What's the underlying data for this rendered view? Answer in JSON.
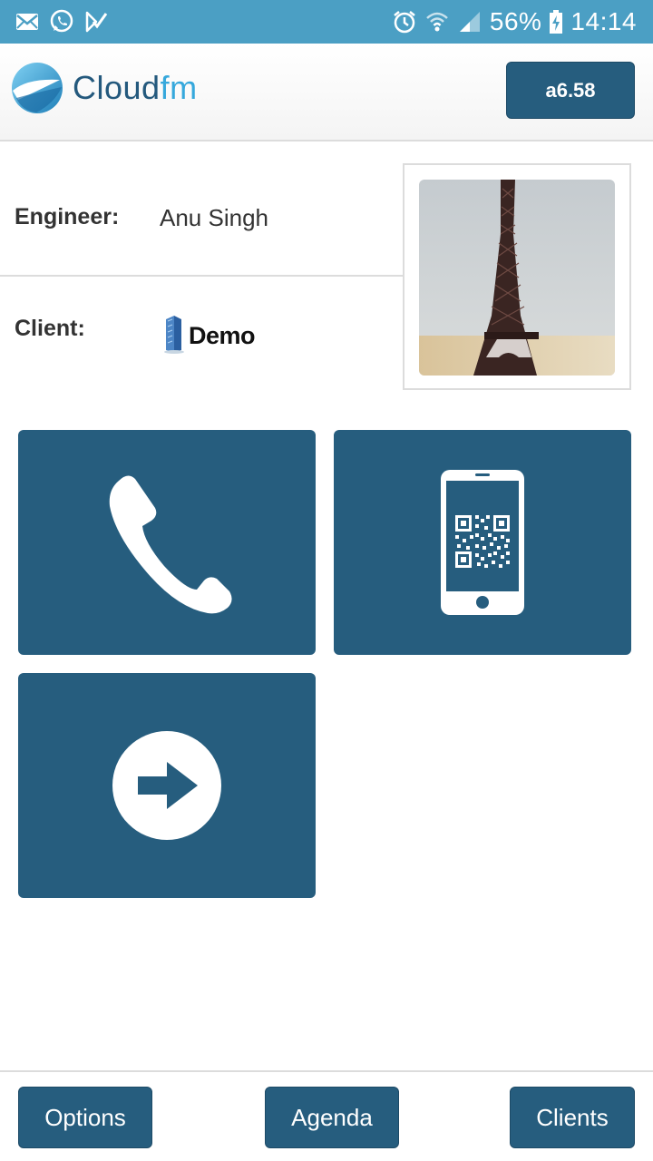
{
  "status_bar": {
    "battery_percent": "56%",
    "time": "14:14",
    "left_icons": [
      "mail-icon",
      "whatsapp-icon",
      "task-check-icon"
    ],
    "right_icons": [
      "alarm-icon",
      "wifi-icon",
      "signal-icon",
      "battery-charging-icon"
    ]
  },
  "header": {
    "app_name_part1": "Cloud",
    "app_name_part2": "fm",
    "version_label": "a6.58"
  },
  "info": {
    "engineer_label": "Engineer:",
    "engineer_name": "Anu Singh",
    "client_label": "Client:",
    "client_name": "Demo"
  },
  "tiles": [
    {
      "name": "call",
      "icon": "phone-icon"
    },
    {
      "name": "scan",
      "icon": "qr-phone-icon"
    },
    {
      "name": "next",
      "icon": "arrow-right-circle-icon"
    }
  ],
  "bottom_nav": {
    "options_label": "Options",
    "agenda_label": "Agenda",
    "clients_label": "Clients"
  },
  "colors": {
    "status_bar": "#4b9fc4",
    "primary": "#265d7e",
    "logo_dark": "#24597d",
    "logo_light": "#36a8dc"
  }
}
